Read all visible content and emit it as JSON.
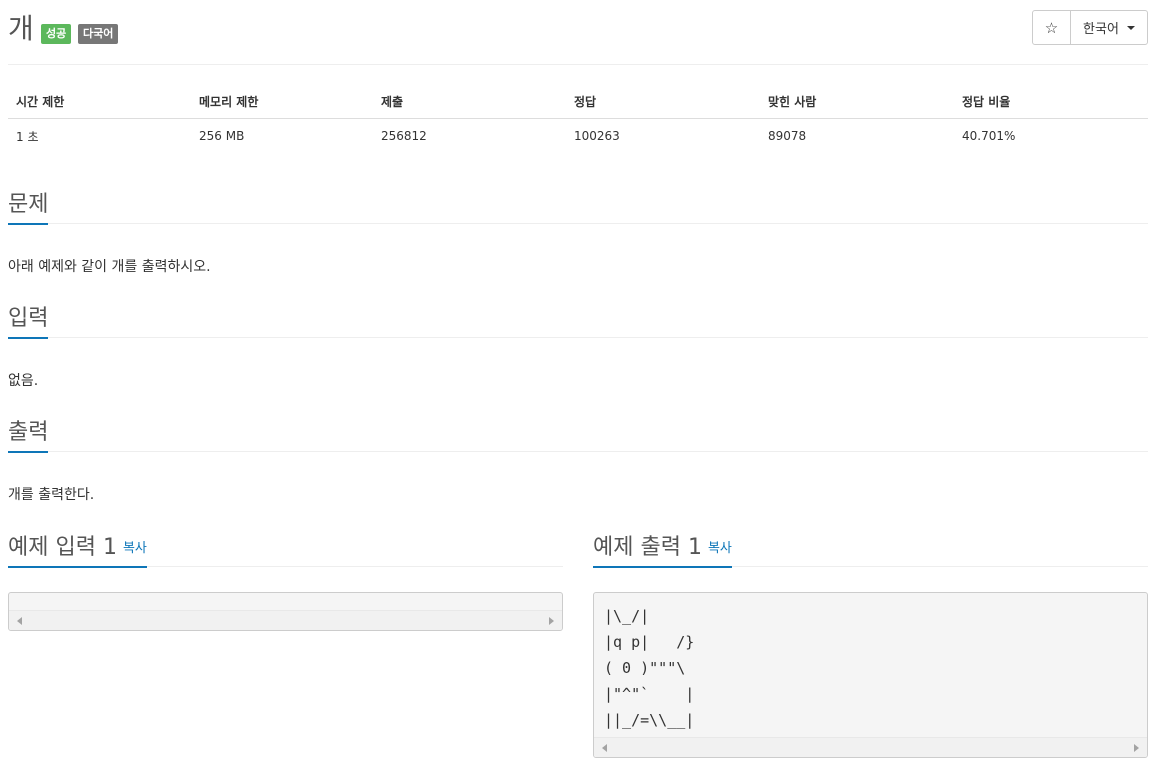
{
  "problem": {
    "title": "개",
    "badges": {
      "success": "성공",
      "multilang": "다국어"
    }
  },
  "controls": {
    "star_icon": "star-icon",
    "language": "한국어"
  },
  "stats": {
    "headers": [
      "시간 제한",
      "메모리 제한",
      "제출",
      "정답",
      "맞힌 사람",
      "정답 비율"
    ],
    "values": [
      "1 초",
      "256 MB",
      "256812",
      "100263",
      "89078",
      "40.701%"
    ]
  },
  "sections": {
    "description": {
      "title": "문제",
      "body": "아래 예제와 같이 개를 출력하시오."
    },
    "input": {
      "title": "입력",
      "body": "없음."
    },
    "output": {
      "title": "출력",
      "body": "개를 출력한다."
    }
  },
  "samples": {
    "input": {
      "title": "예제 입력 1",
      "copy": "복사",
      "content": ""
    },
    "output": {
      "title": "예제 출력 1",
      "copy": "복사",
      "content": "|\\_/|\n|q p|   /}\n( 0 )\"\"\"\\\n|\"^\"`    |\n||_/=\\\\__|"
    }
  },
  "colors": {
    "accent": "#0e76b8",
    "success": "#5cb85c",
    "neutral_badge": "#777777"
  }
}
